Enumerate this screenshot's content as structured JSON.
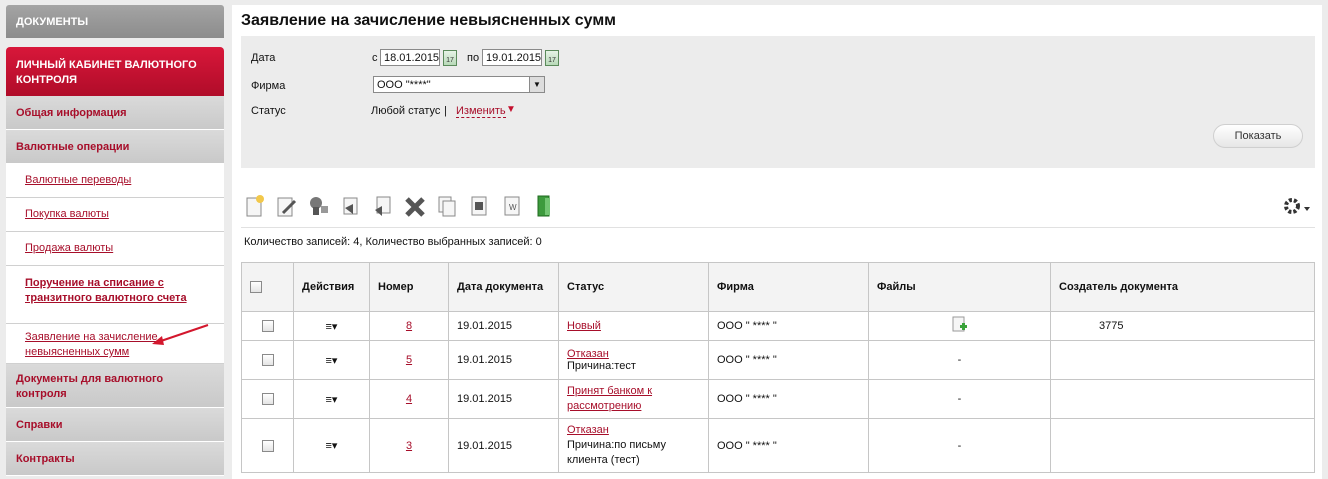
{
  "sidebar": {
    "documents": "ДОКУМЕНТЫ",
    "cabinet": "ЛИЧНЫЙ КАБИНЕТ ВАЛЮТНОГО КОНТРОЛЯ",
    "general": "Общая информация",
    "currency_ops": "Валютные операции",
    "sub_items": [
      "Валютные переводы",
      "Покупка валюты",
      "Продажа валюты",
      "Поручение на списание с транзитного валютного счета",
      "Заявление на зачисление невыясненных сумм"
    ],
    "docs_control": "Документы для валютного контроля",
    "references": "Справки",
    "contracts": "Контракты"
  },
  "page": {
    "title": "Заявление на зачисление невыясненных сумм"
  },
  "filter": {
    "date_label": "Дата",
    "from_prefix": "с",
    "date_from": "18.01.2015",
    "to_prefix": "по",
    "date_to": "19.01.2015",
    "calendar_icon_text": "17",
    "firm_label": "Фирма",
    "firm_value": "ООО \"****\"",
    "status_label": "Статус",
    "status_value": "Любой статус",
    "separator": "|",
    "change_link": "Изменить",
    "change_arrow": "▼",
    "show_button": "Показать"
  },
  "toolbar": {
    "icons": [
      "new-document-icon",
      "edit-icon",
      "sign-icon",
      "send-icon",
      "recall-icon",
      "delete-icon",
      "copy-icon",
      "print-icon",
      "export-word-icon",
      "exit-icon",
      "settings-gear-icon"
    ],
    "gear_caret": "▾"
  },
  "counts": "Количество записей: 4, Количество выбранных записей: 0",
  "table": {
    "headers": {
      "actions": "Действия",
      "number": "Номер",
      "date": "Дата документа",
      "status": "Статус",
      "firm": "Фирма",
      "files": "Файлы",
      "creator": "Создатель документа"
    },
    "action_glyph": "≡▾",
    "rows": [
      {
        "number": "8",
        "date": "19.01.2015",
        "status": "Новый",
        "reason": "",
        "firm": "ООО \" **** \"",
        "files": "attach-file-icon",
        "creator": "3775"
      },
      {
        "number": "5",
        "date": "19.01.2015",
        "status": "Отказан",
        "reason": "Причина:тест",
        "firm": "ООО \" **** \"",
        "files": "-",
        "creator": ""
      },
      {
        "number": "4",
        "date": "19.01.2015",
        "status": "Принят банком к рассмотрению",
        "reason": "",
        "firm": "ООО \" **** \"",
        "files": "-",
        "creator": ""
      },
      {
        "number": "3",
        "date": "19.01.2015",
        "status": "Отказан",
        "reason": "Причина:по письму клиента (тест)",
        "firm": "ООО \" **** \"",
        "files": "-",
        "creator": ""
      }
    ]
  },
  "colors": {
    "accent": "#a70e2a",
    "cabinet": "#c4102f",
    "sidebar_gray": "#cfcfcf"
  }
}
